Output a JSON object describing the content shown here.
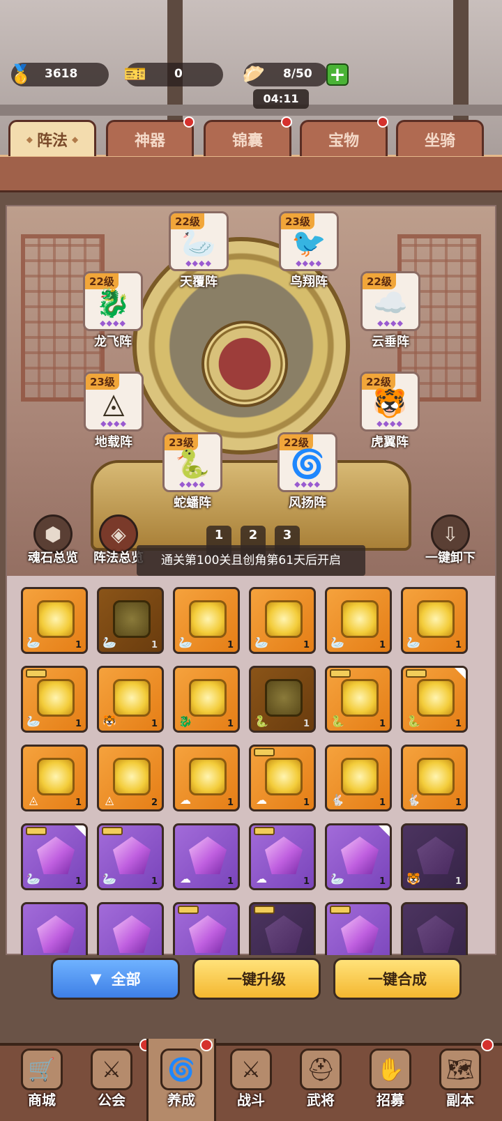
{
  "resources": {
    "gold": {
      "icon": "gold-ingot-icon",
      "value": "3618"
    },
    "ticket": {
      "icon": "gold-ticket-icon",
      "value": "0"
    },
    "stamina": {
      "icon": "bun-icon",
      "value": "8/50"
    },
    "timer": "04:11"
  },
  "tabs": [
    {
      "label": "阵法",
      "active": true,
      "dot": false
    },
    {
      "label": "神器",
      "active": false,
      "dot": true
    },
    {
      "label": "锦囊",
      "active": false,
      "dot": true
    },
    {
      "label": "宝物",
      "active": false,
      "dot": true
    },
    {
      "label": "坐骑",
      "active": false,
      "dot": false
    }
  ],
  "formations": [
    {
      "name": "天覆阵",
      "level": "22级",
      "icon": "crane-icon"
    },
    {
      "name": "鸟翔阵",
      "level": "23级",
      "icon": "phoenix-icon"
    },
    {
      "name": "龙飞阵",
      "level": "22级",
      "icon": "dragon-icon"
    },
    {
      "name": "云垂阵",
      "level": "22级",
      "icon": "cloud-icon"
    },
    {
      "name": "地载阵",
      "level": "23级",
      "icon": "triangle-icon"
    },
    {
      "name": "虎翼阵",
      "level": "22级",
      "icon": "tiger-icon"
    },
    {
      "name": "蛇蟠阵",
      "level": "23级",
      "icon": "snake-icon"
    },
    {
      "name": "风扬阵",
      "level": "22级",
      "icon": "wind-icon"
    }
  ],
  "side_buttons": {
    "soul_overview": "魂石总览",
    "formation_overview": "阵法总览",
    "unload_all": "一键卸下"
  },
  "pages": [
    "1",
    "2",
    "3"
  ],
  "toast": "通关第100关且创角第61天后开启",
  "inventory": [
    {
      "type": "o",
      "mark": "crane",
      "count": "1"
    },
    {
      "type": "od",
      "mark": "crane",
      "count": "1"
    },
    {
      "type": "o",
      "mark": "crane",
      "count": "1"
    },
    {
      "type": "o",
      "mark": "crane",
      "count": "1"
    },
    {
      "type": "o",
      "mark": "crane",
      "count": "1"
    },
    {
      "type": "o",
      "mark": "crane",
      "count": "1"
    },
    {
      "type": "o",
      "mark": "crane",
      "count": "1",
      "equipped": true
    },
    {
      "type": "o",
      "mark": "tiger",
      "count": "1"
    },
    {
      "type": "o",
      "mark": "dragon",
      "count": "1"
    },
    {
      "type": "od",
      "mark": "snake",
      "count": "1"
    },
    {
      "type": "o",
      "mark": "snake",
      "count": "1",
      "equipped": true
    },
    {
      "type": "o",
      "mark": "snake",
      "count": "1",
      "equipped": true,
      "corner": true
    },
    {
      "type": "o",
      "mark": "triangle",
      "count": "1"
    },
    {
      "type": "o",
      "mark": "triangle",
      "count": "2"
    },
    {
      "type": "o",
      "mark": "cloud",
      "count": "1"
    },
    {
      "type": "o",
      "mark": "cloud",
      "count": "1",
      "equipped": true
    },
    {
      "type": "o",
      "mark": "rabbit",
      "count": "1"
    },
    {
      "type": "o",
      "mark": "rabbit",
      "count": "1"
    },
    {
      "type": "p",
      "mark": "crane",
      "count": "1",
      "equipped": true,
      "corner": true
    },
    {
      "type": "p",
      "mark": "crane",
      "count": "1",
      "equipped": true
    },
    {
      "type": "p",
      "mark": "cloud",
      "count": "1"
    },
    {
      "type": "p",
      "mark": "cloud",
      "count": "1",
      "equipped": true
    },
    {
      "type": "p",
      "mark": "crane",
      "count": "1",
      "corner": true
    },
    {
      "type": "pd",
      "mark": "tiger",
      "count": "1"
    },
    {
      "type": "p",
      "mark": "",
      "count": ""
    },
    {
      "type": "p",
      "mark": "",
      "count": ""
    },
    {
      "type": "p",
      "mark": "",
      "count": "",
      "equipped": true
    },
    {
      "type": "pd",
      "mark": "",
      "count": "",
      "equipped": true
    },
    {
      "type": "p",
      "mark": "",
      "count": "",
      "equipped": true
    },
    {
      "type": "pd",
      "mark": "",
      "count": ""
    }
  ],
  "buttons": {
    "filter": "全部",
    "upgrade_all": "一键升级",
    "merge_all": "一键合成"
  },
  "nav": [
    {
      "label": "商城",
      "icon": "shop-icon",
      "dot": false
    },
    {
      "label": "公会",
      "icon": "guild-icon",
      "dot": true
    },
    {
      "label": "养成",
      "icon": "cultivate-icon",
      "dot": true,
      "active": true
    },
    {
      "label": "战斗",
      "icon": "battle-icon",
      "dot": false
    },
    {
      "label": "武将",
      "icon": "general-icon",
      "dot": false
    },
    {
      "label": "招募",
      "icon": "recruit-icon",
      "dot": false
    },
    {
      "label": "副本",
      "icon": "dungeon-icon",
      "dot": true
    }
  ],
  "colors": {
    "orange": "#e98a22",
    "purple": "#8d56c8",
    "blue": "#4a8cf0",
    "gold": "#f4b730",
    "red_dot": "#d5312d"
  }
}
